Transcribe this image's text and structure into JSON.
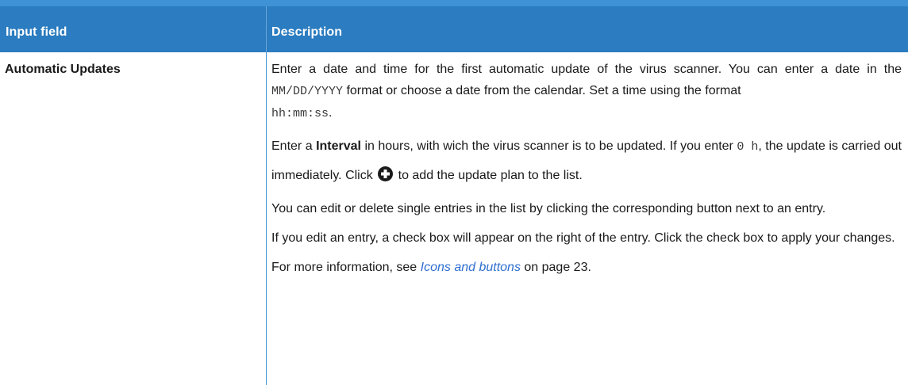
{
  "table": {
    "headers": {
      "input_field": "Input field",
      "description": "Description"
    },
    "row": {
      "input_field": "Automatic Updates",
      "p1": {
        "t1": "Enter a date and time for the first automatic update of the virus scanner. You can enter a date in the ",
        "code_date": "MM/DD/YYYY",
        "t2": " format or choose a date from the calendar. Set a time using the format ",
        "code_time": "hh:mm:ss",
        "t3": "."
      },
      "p2": {
        "t1": "Enter a ",
        "bold": "Interval",
        "t2": " in hours, with wich the virus scanner is to be updated. If you enter ",
        "code_zero": "0 h",
        "t3": ", the update is carried out immediately. Click ",
        "icon": "plus-circle-icon",
        "t4": " to add the update plan to the list."
      },
      "p3": "You can edit or delete single entries in the list by clicking the corresponding button next to an entry.",
      "p4": "If you edit an entry, a check box will appear on the right of the entry. Click the check box to apply your changes.",
      "p5": {
        "t1": "For more information, see ",
        "link": "Icons and buttons",
        "t2": " on page 23."
      }
    }
  },
  "colors": {
    "header_bg": "#2b7cc0",
    "header_top": "#3f92d6",
    "link": "#2f6fd1"
  }
}
